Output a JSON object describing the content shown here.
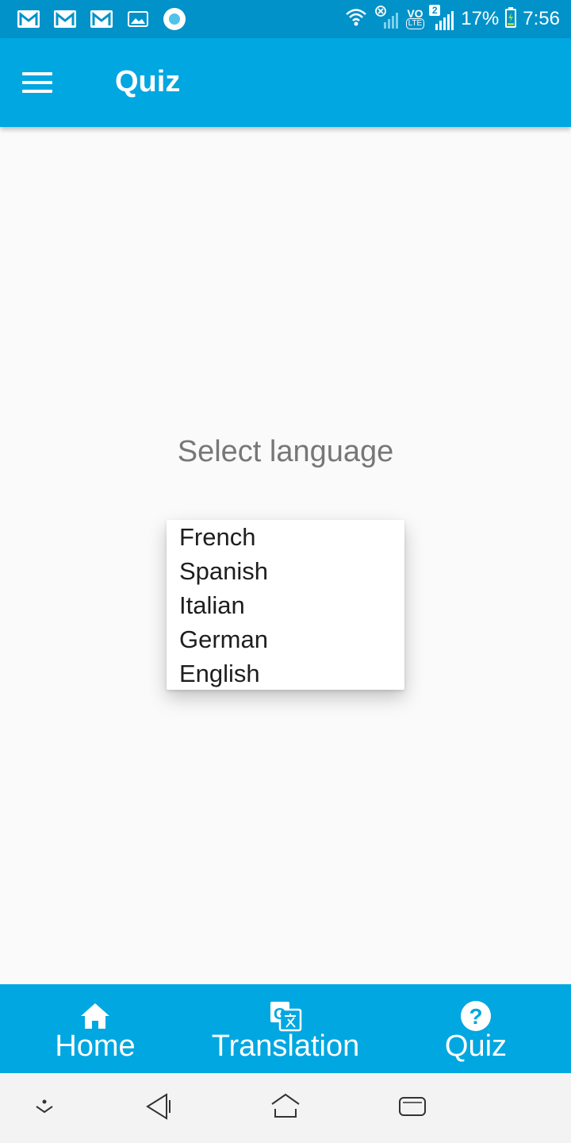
{
  "status_bar": {
    "icons_left": [
      "gmail-icon",
      "gmail-icon",
      "gmail-icon",
      "image-icon",
      "circle-app-icon"
    ],
    "battery": "17%",
    "time": "7:56",
    "sim_badge": "2",
    "volte_top": "VO",
    "volte_bottom": "LTE"
  },
  "app_bar": {
    "title": "Quiz"
  },
  "main": {
    "prompt": "Select language",
    "languages": [
      "French",
      "Spanish",
      "Italian",
      "German",
      "English"
    ]
  },
  "bottom_nav": {
    "items": [
      {
        "label": "Home",
        "icon": "home-icon"
      },
      {
        "label": "Translation",
        "icon": "translate-icon"
      },
      {
        "label": "Quiz",
        "icon": "help-icon"
      }
    ]
  },
  "colors": {
    "status_bar": "#0092c9",
    "app_bar": "#00a7e1",
    "background": "#fafafa",
    "prompt_text": "#777777"
  }
}
